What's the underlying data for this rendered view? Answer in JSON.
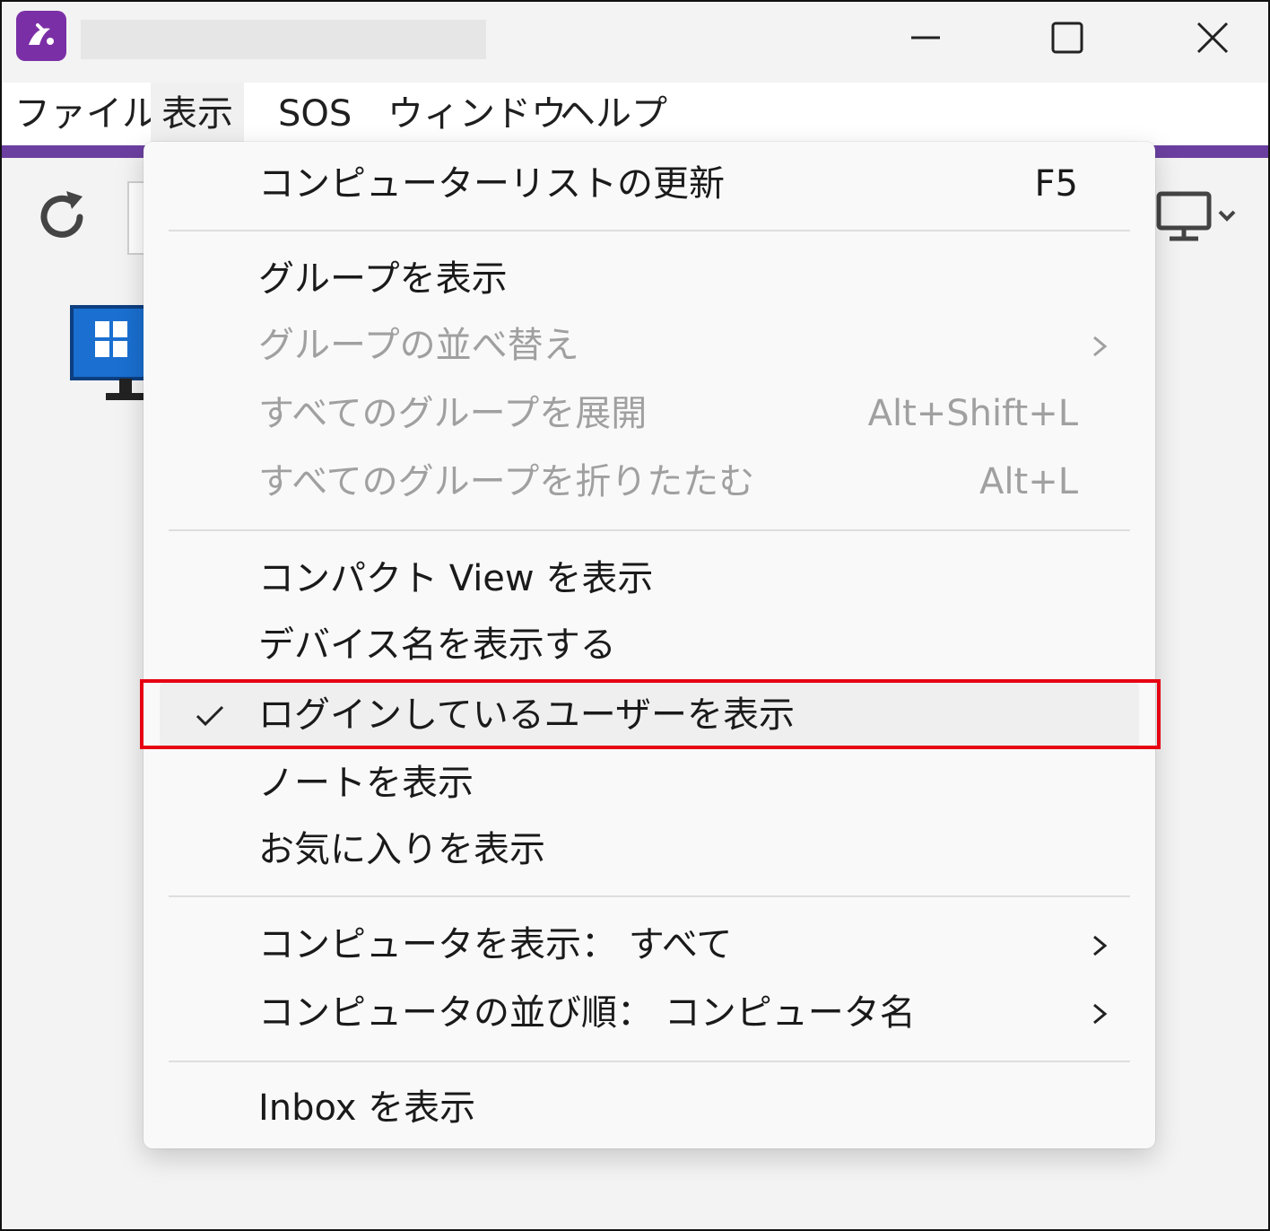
{
  "menubar": {
    "items": [
      {
        "label": "ファイル"
      },
      {
        "label": "表示"
      },
      {
        "label": "SOS"
      },
      {
        "label": "ウィンドウ"
      },
      {
        "label": "ヘルプ"
      }
    ]
  },
  "window_controls": {
    "icons": [
      "minimize-icon",
      "maximize-icon",
      "close-icon"
    ]
  },
  "colors": {
    "accent": "#6b3fa0",
    "highlight_border": "#e60012",
    "disabled_text": "#a0a0a0"
  },
  "view_menu": {
    "refresh": {
      "label": "コンピューターリストの更新",
      "shortcut": "F5"
    },
    "show_groups": {
      "label": "グループを表示"
    },
    "sort_groups": {
      "label": "グループの並べ替え"
    },
    "expand_all": {
      "label": "すべてのグループを展開",
      "shortcut": "Alt+Shift+L"
    },
    "collapse_all": {
      "label": "すべてのグループを折りたたむ",
      "shortcut": "Alt+L"
    },
    "compact_view": {
      "label": "コンパクト View を表示"
    },
    "device_name": {
      "label": "デバイス名を表示する"
    },
    "logged_in_user": {
      "label": "ログインしているユーザーを表示",
      "checked": true
    },
    "notes": {
      "label": "ノートを表示"
    },
    "favorites": {
      "label": "お気に入りを表示"
    },
    "show_computers": {
      "label": "コンピュータを表示： すべて"
    },
    "sort_computers": {
      "label": "コンピュータの並び順： コンピュータ名"
    },
    "inbox": {
      "label": "Inbox を表示"
    }
  }
}
